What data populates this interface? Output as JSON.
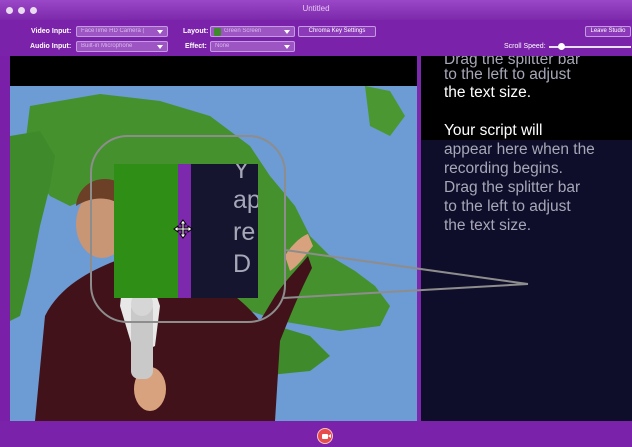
{
  "window": {
    "title": "Untitled"
  },
  "toolbar": {
    "video_input_label": "Video Input:",
    "video_input_value": "FaceTime HD Camera (Built-in)",
    "audio_input_label": "Audio Input:",
    "audio_input_value": "Built-in Microphone",
    "layout_label": "Layout:",
    "layout_value": "Green Screen",
    "effect_label": "Effect:",
    "effect_value": "None",
    "chroma_button": "Chroma Key Settings",
    "leave_button": "Leave Studio",
    "scroll_speed_label": "Scroll Speed:",
    "scroll_speed_value": 0.15
  },
  "script": {
    "line_top_1": "Drag the splitter bar",
    "line_top_2": "to the left to adjust",
    "line_top_3": "the text size.",
    "line_1": "Your script will",
    "line_2": "appear here when the",
    "line_3": "recording begins.",
    "line_4": "Drag the splitter bar",
    "line_5": "to the left to adjust",
    "line_6": "the text size."
  },
  "zoom_text": {
    "l1": "Y",
    "l2": "ap",
    "l3": "re",
    "l4": "D"
  },
  "icons": {
    "record": "record-video-icon",
    "splitter": "move-arrows-icon"
  },
  "colors": {
    "accent": "#7b22aa",
    "green_screen": "#2f8e16",
    "record": "#e74c4c",
    "script_bg": "#0e0e2a"
  }
}
